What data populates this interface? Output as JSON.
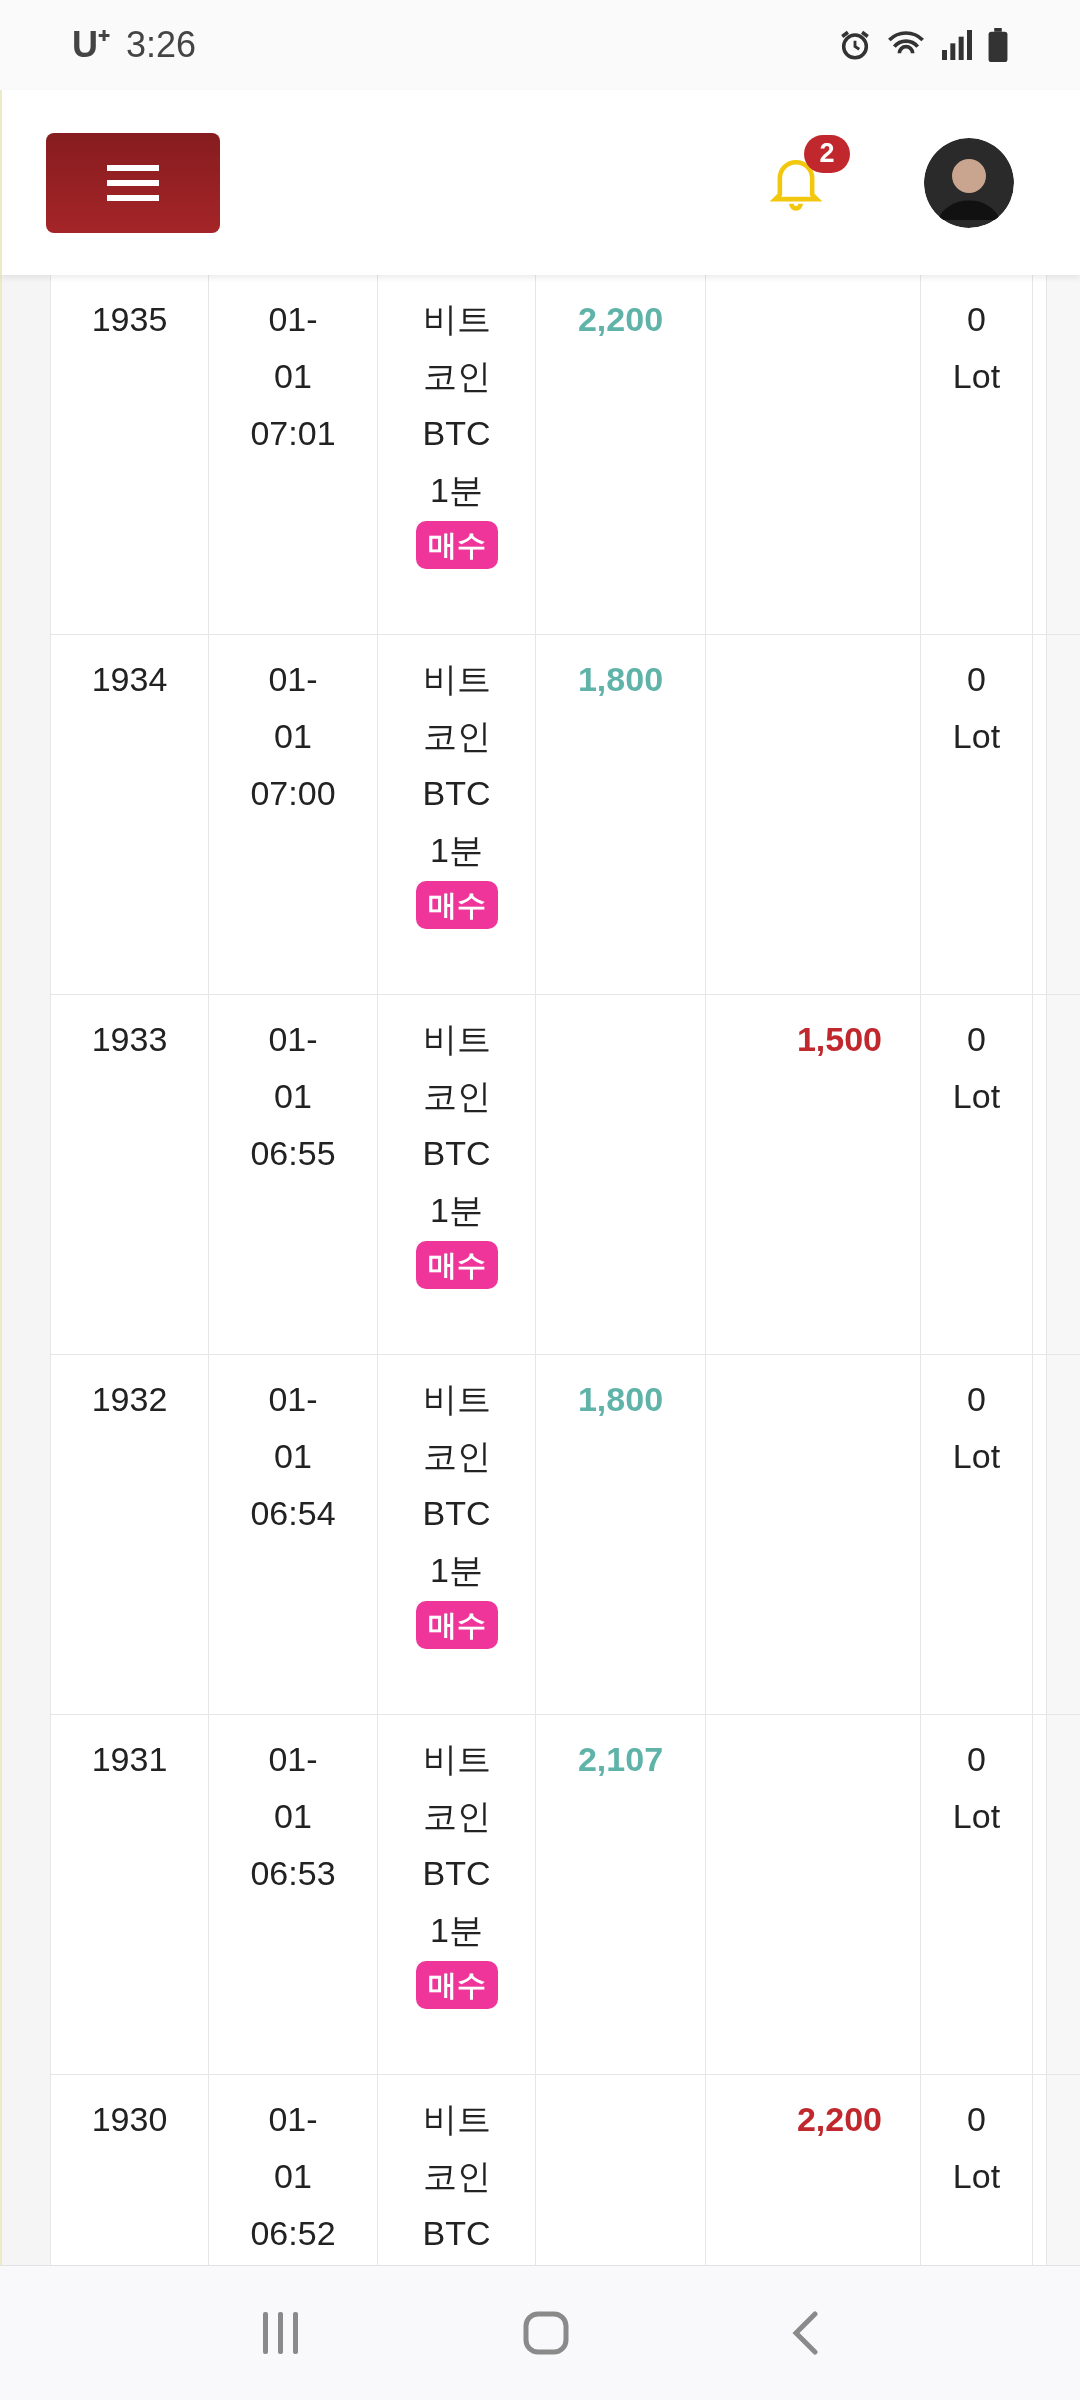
{
  "status_bar": {
    "carrier": "U⁺",
    "time": "3:26"
  },
  "header": {
    "notifications": {
      "count": "2"
    }
  },
  "rows": [
    {
      "id": "1935",
      "date": [
        "01-",
        "01",
        "07:01"
      ],
      "asset": [
        "비트",
        "코인",
        "BTC",
        "1분"
      ],
      "side": "매수",
      "amount": {
        "kind": "profit",
        "value": "2,200"
      },
      "lot": [
        "0",
        "Lot"
      ]
    },
    {
      "id": "1934",
      "date": [
        "01-",
        "01",
        "07:00"
      ],
      "asset": [
        "비트",
        "코인",
        "BTC",
        "1분"
      ],
      "side": "매수",
      "amount": {
        "kind": "profit",
        "value": "1,800"
      },
      "lot": [
        "0",
        "Lot"
      ]
    },
    {
      "id": "1933",
      "date": [
        "01-",
        "01",
        "06:55"
      ],
      "asset": [
        "비트",
        "코인",
        "BTC",
        "1분"
      ],
      "side": "매수",
      "amount": {
        "kind": "loss",
        "value": "1,500"
      },
      "lot": [
        "0",
        "Lot"
      ]
    },
    {
      "id": "1932",
      "date": [
        "01-",
        "01",
        "06:54"
      ],
      "asset": [
        "비트",
        "코인",
        "BTC",
        "1분"
      ],
      "side": "매수",
      "amount": {
        "kind": "profit",
        "value": "1,800"
      },
      "lot": [
        "0",
        "Lot"
      ]
    },
    {
      "id": "1931",
      "date": [
        "01-",
        "01",
        "06:53"
      ],
      "asset": [
        "비트",
        "코인",
        "BTC",
        "1분"
      ],
      "side": "매수",
      "amount": {
        "kind": "profit",
        "value": "2,107"
      },
      "lot": [
        "0",
        "Lot"
      ]
    },
    {
      "id": "1930",
      "date": [
        "01-",
        "01",
        "06:52"
      ],
      "asset": [
        "비트",
        "코인",
        "BTC"
      ],
      "amount": {
        "kind": "loss",
        "value": "2,200"
      },
      "lot": [
        "0",
        "Lot"
      ]
    }
  ]
}
